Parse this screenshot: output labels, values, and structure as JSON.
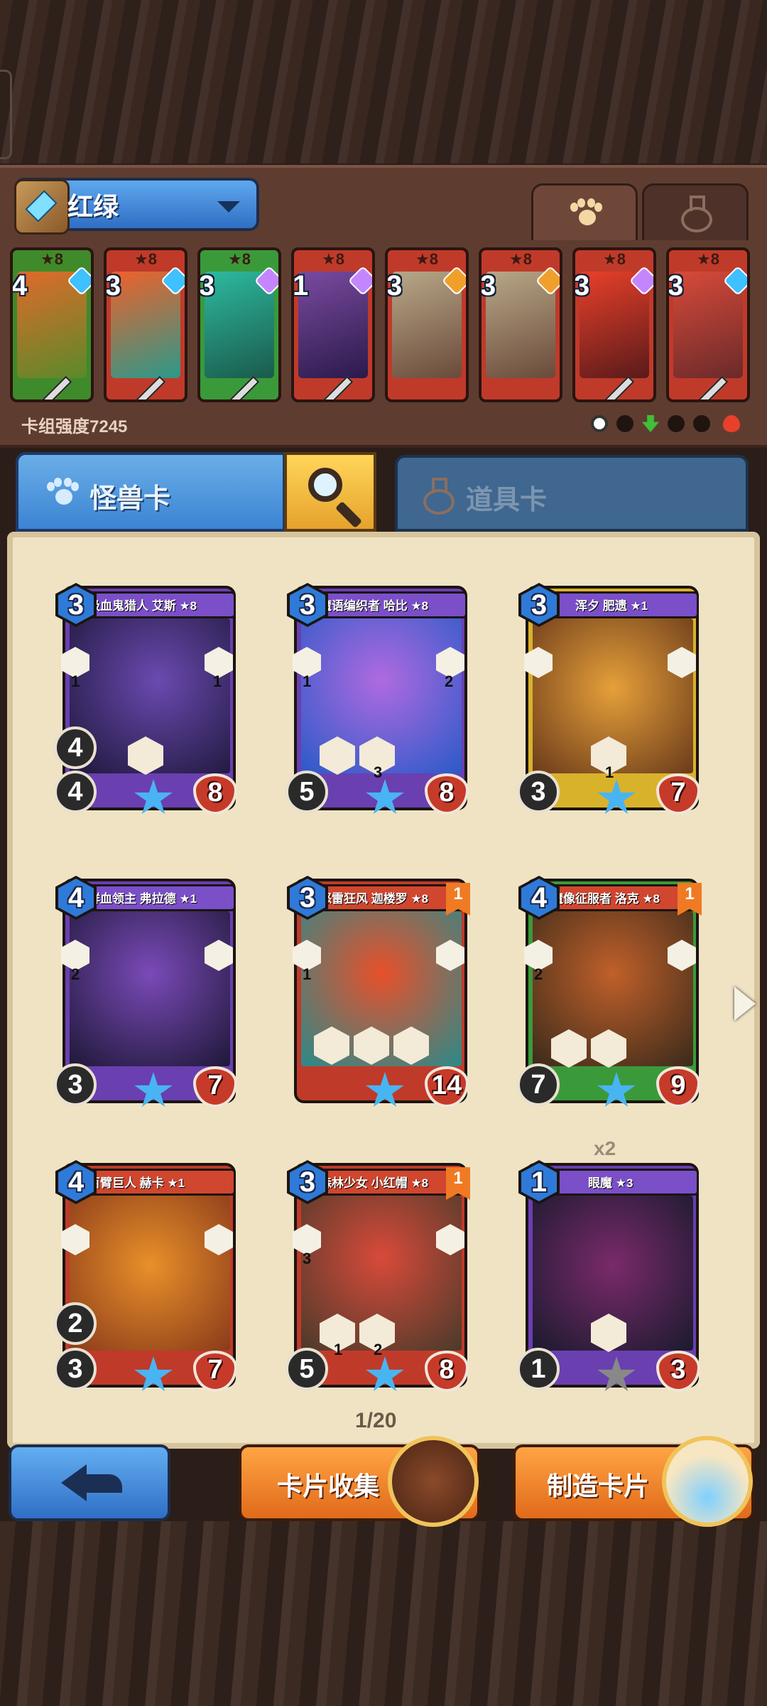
{
  "deck": {
    "name": "红绿",
    "power_text": "卡组强度7245",
    "cards": [
      {
        "cost": "4",
        "stars": "★8",
        "gem": "#3fc0ff",
        "color": "#3f8a2a",
        "art": "#c04a2a"
      },
      {
        "cost": "3",
        "stars": "★8",
        "gem": "#3fc0ff",
        "color": "#c03a2a",
        "art": "#d8452e"
      },
      {
        "cost": "3",
        "stars": "★8",
        "gem": "#c486ff",
        "color": "#3a9a3a",
        "art": "#2d9a8a"
      },
      {
        "cost": "1",
        "stars": "★8",
        "gem": "#c486ff",
        "color": "#c03a2a",
        "art": "#5a3a7a"
      },
      {
        "cost": "3",
        "stars": "★8",
        "gem": "#f0a02a",
        "color": "#c03a2a",
        "art": "#9a8a6a"
      },
      {
        "cost": "3",
        "stars": "★8",
        "gem": "#f0a02a",
        "color": "#c03a2a",
        "art": "#9a8a6a"
      },
      {
        "cost": "3",
        "stars": "★8",
        "gem": "#c486ff",
        "color": "#c03a2a",
        "art": "#c02a2a"
      },
      {
        "cost": "3",
        "stars": "★8",
        "gem": "#3fc0ff",
        "color": "#c03a2a",
        "art": "#b84a3a"
      }
    ]
  },
  "tabs": {
    "monster": "怪兽卡",
    "item": "道具卡"
  },
  "cards": [
    {
      "name": "吸血鬼猎人 艾斯 ★8",
      "cost": "3",
      "left_num": "1",
      "right_num": "1",
      "atk": "4",
      "circ2": "4",
      "hp": "8",
      "frame": "#6a3fb0",
      "bar": "#6a3fb0",
      "art": "#2c2254"
    },
    {
      "name": "魔语编织者 哈比 ★8",
      "cost": "3",
      "left_num": "1",
      "right_num": "2",
      "atk": "",
      "circ2": "5",
      "hp": "8",
      "ability_num": "3",
      "frame": "#6a3fb0",
      "bar": "#6a3fb0",
      "art": "#3a6ac8"
    },
    {
      "name": "浑夕 肥遗 ★1",
      "cost": "3",
      "left_num": "",
      "right_num": "",
      "atk": "",
      "circ2": "3",
      "hp": "7",
      "ability_num": "1",
      "frame": "#d9b22c",
      "bar": "#6a3fb0",
      "art": "#c88a2a"
    },
    {
      "name": "鲜血领主 弗拉德 ★1",
      "cost": "4",
      "left_num": "2",
      "right_num": "",
      "atk": "",
      "circ2": "3",
      "hp": "7",
      "frame": "#6a3fb0",
      "bar": "#6a3fb0",
      "art": "#3a2a6a"
    },
    {
      "name": "怒雷狂风 迦楼罗 ★8",
      "cost": "3",
      "left_num": "1",
      "right_num": "",
      "atk": "",
      "circ2": "",
      "hp": "14",
      "badge": "1",
      "frame": "#c03a2a",
      "bar": "#c03a2a",
      "art": "#b8342a"
    },
    {
      "name": "魔像征服者 洛克 ★8",
      "cost": "4",
      "left_num": "2",
      "right_num": "",
      "atk": "",
      "circ2": "7",
      "hp": "9",
      "badge": "1",
      "frame": "#3a9a3a",
      "bar": "#c03a2a",
      "art": "#8a4a2a"
    },
    {
      "name": "百臂巨人 赫卡 ★1",
      "cost": "4",
      "left_num": "",
      "right_num": "",
      "atk": "2",
      "circ2": "3",
      "hp": "7",
      "frame": "#c03a2a",
      "bar": "#c03a2a",
      "art": "#d07a2a"
    },
    {
      "name": "森林少女 小红帽 ★8",
      "cost": "3",
      "left_num": "3",
      "right_num": "",
      "atk": "",
      "circ2": "5",
      "hp": "8",
      "badge": "1",
      "ability_num": "1",
      "ability_num2": "2",
      "frame": "#c03a2a",
      "bar": "#c03a2a",
      "art": "#8a5a3a"
    },
    {
      "name": "眼魔 ★3",
      "cost": "1",
      "left_num": "",
      "right_num": "",
      "atk": "",
      "circ2": "1",
      "hp": "3",
      "frame": "#6a3fb0",
      "bar": "#6a3fb0",
      "art": "#2a2a4a"
    }
  ],
  "count_label": "x2",
  "page_indicator": "1/20",
  "buttons": {
    "collect": "卡片收集",
    "craft": "制造卡片"
  }
}
